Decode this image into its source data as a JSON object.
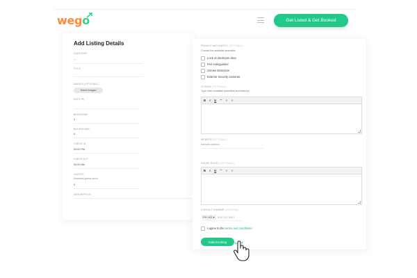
{
  "header": {
    "logo_text_a": "weg",
    "logo_text_b": "o",
    "cta_label": "Get Listed & Get Booked"
  },
  "left": {
    "title": "Add Listing Details",
    "fields": [
      {
        "label": "Category",
        "value": "–"
      },
      {
        "label": "Title",
        "value": ""
      },
      {
        "label": "Images (optional)",
        "value": "Select Images"
      },
      {
        "label": "Rate (₱)",
        "value": ""
      },
      {
        "label": "Bedrooms",
        "value": "0"
      },
      {
        "label": "Bathrooms",
        "value": "0"
      },
      {
        "label": "Check in",
        "value": "00:00 PM"
      },
      {
        "label": "Check out",
        "value": "00:00 AM"
      },
      {
        "label": "Guests",
        "value": "Maximum guests count"
      },
      {
        "label": "",
        "value": "0"
      },
      {
        "label": "Description",
        "value": ""
      }
    ]
  },
  "right": {
    "privacy_label": "Privacy and safety",
    "privacy_optional": "(optional)",
    "privacy_sub": "Choose the available amenities",
    "amenities": [
      "Lock on bedroom door",
      "Fire extinguisher",
      "Smoke Detectors",
      "Exterior security cameras"
    ],
    "others_label": "Others",
    "others_optional": "(optional)",
    "others_sub": "Type other available amenities and features",
    "toolbar": [
      "B",
      "I",
      "U",
      "“”",
      "≡",
      "≡"
    ],
    "website_label": "Website",
    "website_optional": "(optional)",
    "website_placeholder": "Website address",
    "house_rules_label": "House Rules",
    "house_rules_optional": "(optional)",
    "contact_label": "Contact Number",
    "contact_optional": "(optional)",
    "country_code": "PH +63 ▾",
    "phone_placeholder": "905 123 4567",
    "agree_prefix": "I agree to the ",
    "agree_link": "terms and conditions",
    "submit_label": "Submit Listing"
  },
  "colors": {
    "accent": "#22c98a",
    "logo_orange": "#ff8a3d"
  }
}
